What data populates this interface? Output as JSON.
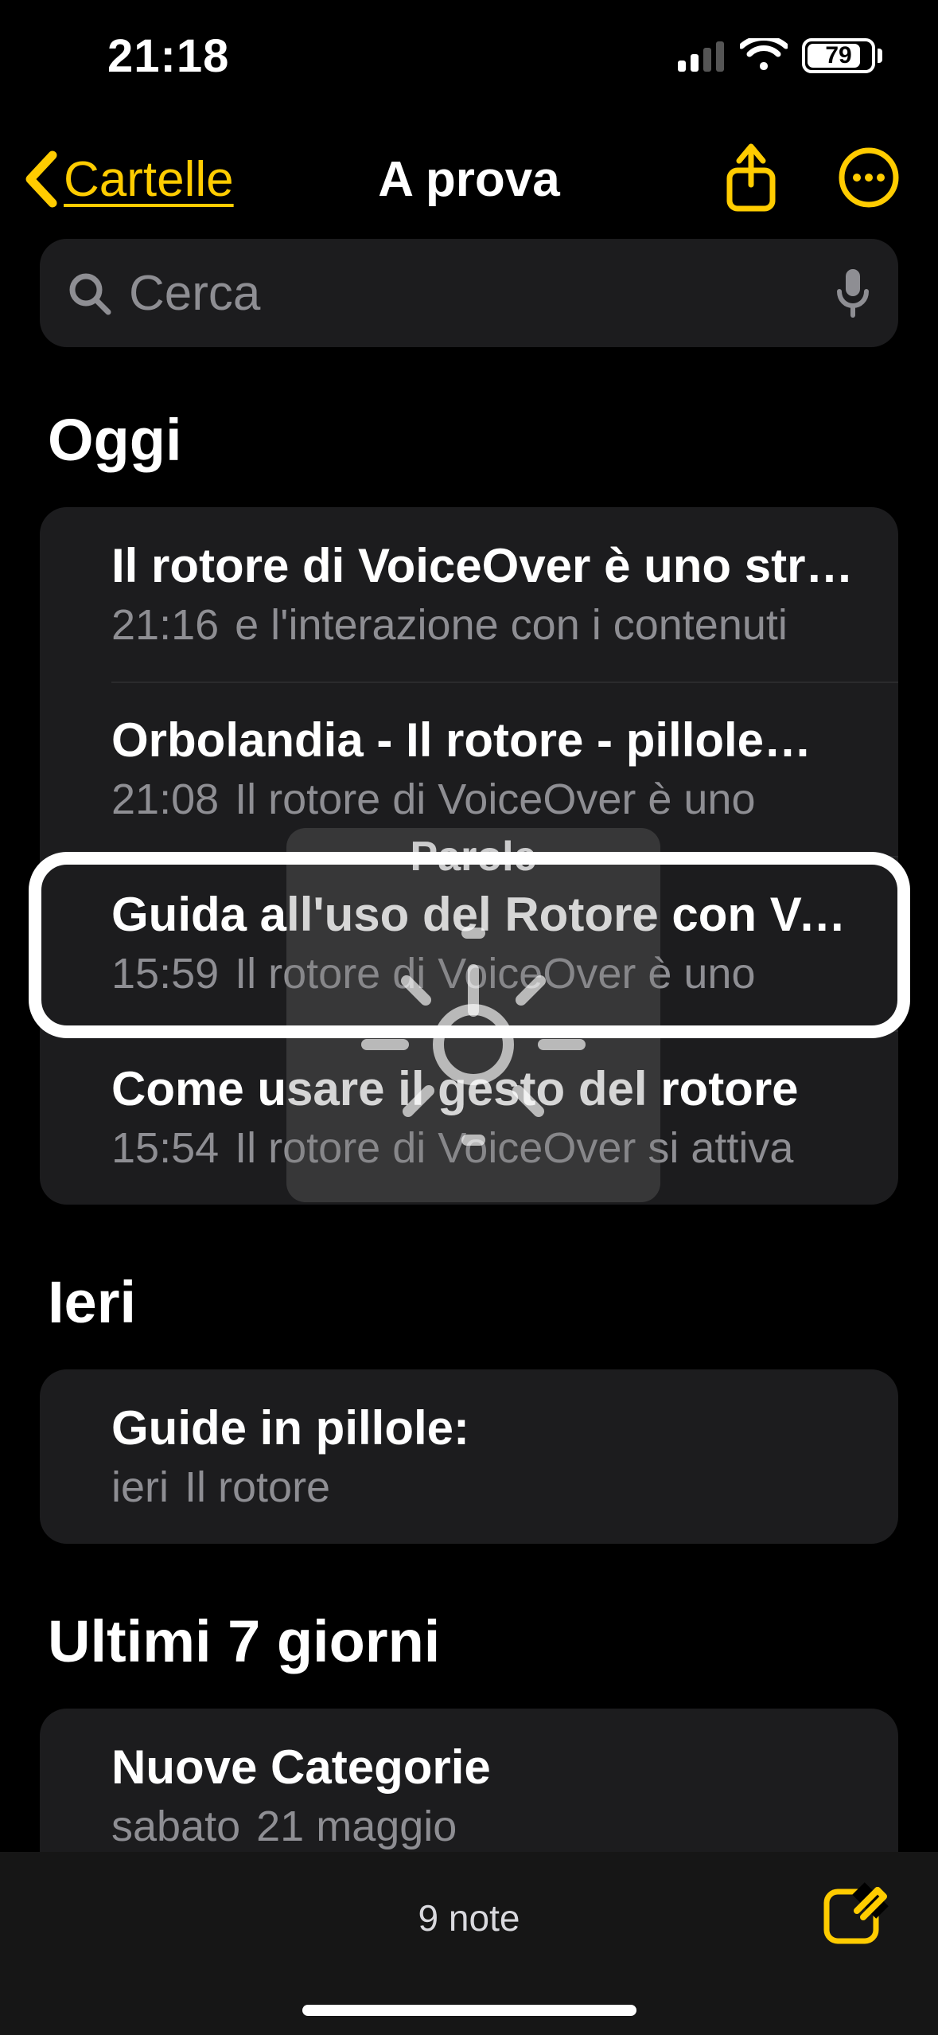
{
  "status": {
    "time": "21:18",
    "battery_percent": "79"
  },
  "nav": {
    "back_label": "Cartelle",
    "title": "A prova"
  },
  "search": {
    "placeholder": "Cerca"
  },
  "rotor": {
    "label": "Parole"
  },
  "sections": [
    {
      "header": "Oggi",
      "notes": [
        {
          "title": "Il rotore di VoiceOver è uno strumento",
          "time": "21:16",
          "preview": "e l'interazione con i contenuti"
        },
        {
          "title": "Orbolandia - Il rotore - pillole…",
          "time": "21:08",
          "preview": "Il rotore di VoiceOver è uno"
        },
        {
          "title": "Guida all'uso del Rotore con VoiceOver",
          "time": "15:59",
          "preview": "Il rotore di VoiceOver è uno"
        },
        {
          "title": "Come usare il gesto del rotore",
          "time": "15:54",
          "preview": "Il rotore di VoiceOver si attiva"
        }
      ]
    },
    {
      "header": "Ieri",
      "notes": [
        {
          "title": "Guide in pillole:",
          "time": "ieri",
          "preview": "Il rotore"
        }
      ]
    },
    {
      "header": "Ultimi 7 giorni",
      "notes": [
        {
          "title": "Nuove Categorie",
          "time": "sabato",
          "preview": "21 maggio"
        }
      ]
    }
  ],
  "toolbar": {
    "count_label": "9 note"
  },
  "colors": {
    "accent": "#FFCC00"
  }
}
